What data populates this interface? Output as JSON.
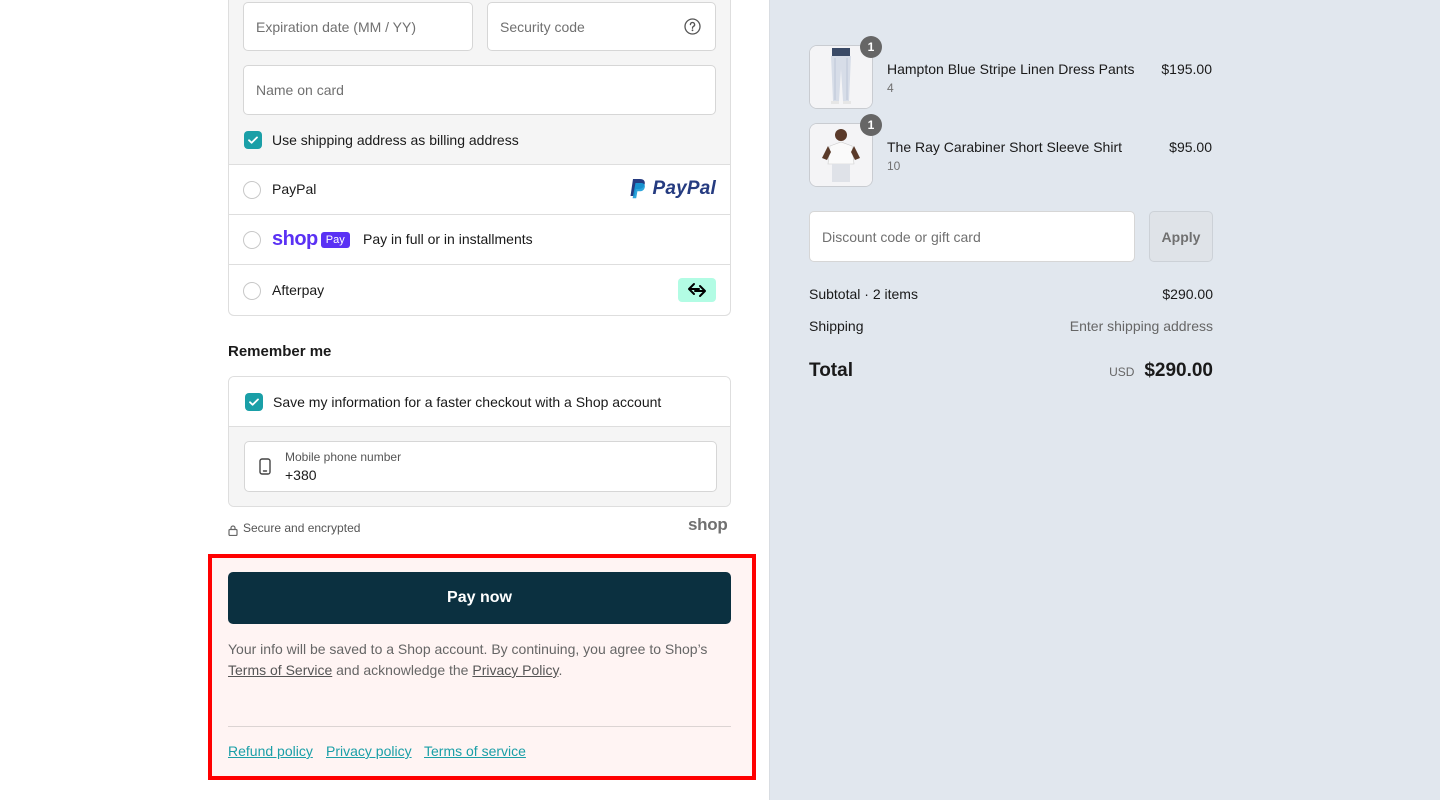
{
  "card": {
    "expiration_placeholder": "Expiration date (MM / YY)",
    "security_placeholder": "Security code",
    "name_placeholder": "Name on card",
    "billing_same_label": "Use shipping address as billing address"
  },
  "payment_options": {
    "paypal_label": "PayPal",
    "paypal_logo_text": "PayPal",
    "shoppay_label": "Pay in full or in installments",
    "shoppay_logo_text": "shop",
    "shoppay_badge": "Pay",
    "afterpay_label": "Afterpay"
  },
  "remember_me": {
    "title": "Remember me",
    "save_label": "Save my information for a faster checkout with a Shop account",
    "phone_label": "Mobile phone number",
    "phone_value": "+380"
  },
  "security": {
    "secure_text": "Secure and encrypted",
    "shop_logo_text": "shop"
  },
  "checkout": {
    "pay_now_label": "Pay now",
    "legal_text_1": "Your info will be saved to a Shop account. By continuing, you agree to Shop’s",
    "terms_link": "Terms of Service",
    "legal_text_2": "and acknowledge the",
    "privacy_link": "Privacy Policy",
    "legal_text_3": "."
  },
  "footer": {
    "refund_policy": "Refund policy",
    "privacy_policy": "Privacy policy",
    "terms_of_service": "Terms of service"
  },
  "order": {
    "items": [
      {
        "name": "Hampton Blue Stripe Linen Dress Pants",
        "variant": "4",
        "price": "$195.00",
        "quantity": "1"
      },
      {
        "name": "The Ray Carabiner Short Sleeve Shirt",
        "variant": "10",
        "price": "$95.00",
        "quantity": "1"
      }
    ],
    "discount_placeholder": "Discount code or gift card",
    "apply_label": "Apply",
    "subtotal_label": "Subtotal · 2 items",
    "subtotal_value": "$290.00",
    "shipping_label": "Shipping",
    "shipping_value": "Enter shipping address",
    "total_label": "Total",
    "currency": "USD",
    "total_value": "$290.00"
  },
  "colors": {
    "accent": "#1a9fa7",
    "pay_button": "#0b3040",
    "shop_purple": "#5a31f4",
    "paypal_blue": "#253b80",
    "paypal_light": "#179bd7",
    "afterpay_mint": "#b2fce4",
    "highlight_border": "#ff0000"
  }
}
